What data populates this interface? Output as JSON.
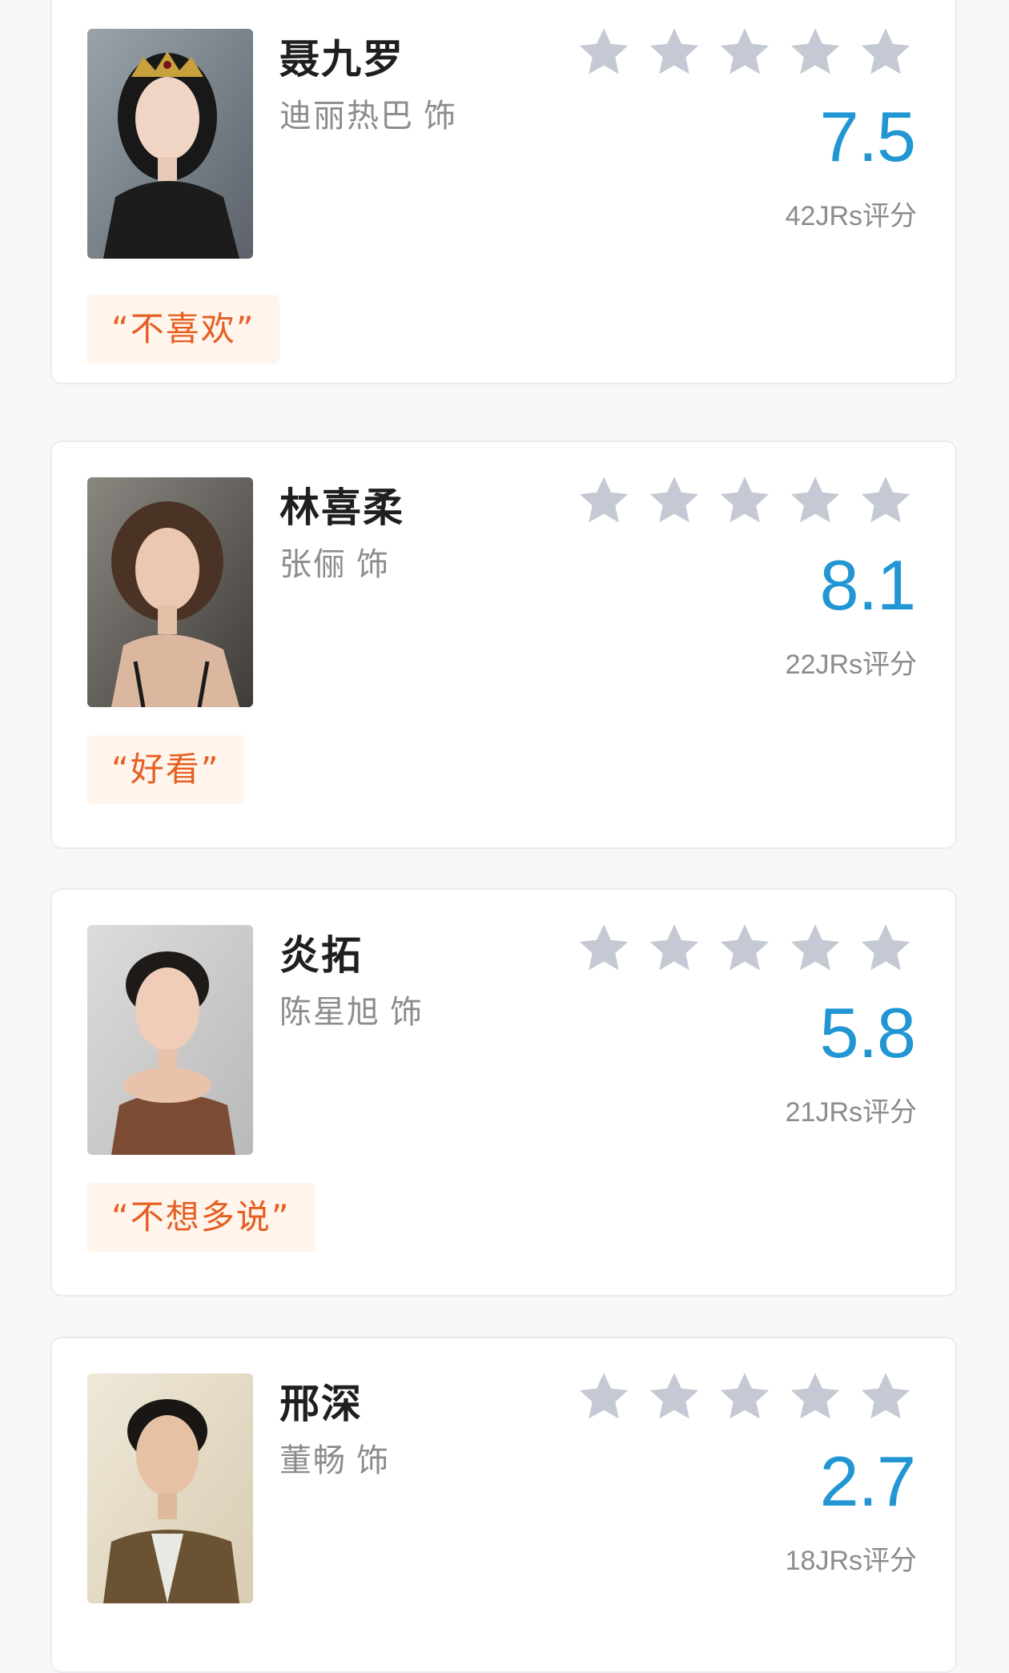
{
  "colors": {
    "accent_score": "#2196d3",
    "star_empty": "#c4c9d4",
    "comment_text": "#e65e21",
    "comment_bg": "#fff5ec"
  },
  "characters": [
    {
      "name": "聂九罗",
      "actor": "迪丽热巴",
      "actor_suffix": "饰",
      "score": "7.5",
      "rating_count": "42JRs评分",
      "comment": "“不喜欢”",
      "stars_filled": 0,
      "stars_total": 5
    },
    {
      "name": "林喜柔",
      "actor": "张俪",
      "actor_suffix": "饰",
      "score": "8.1",
      "rating_count": "22JRs评分",
      "comment": "“好看”",
      "stars_filled": 0,
      "stars_total": 5
    },
    {
      "name": "炎拓",
      "actor": "陈星旭",
      "actor_suffix": "饰",
      "score": "5.8",
      "rating_count": "21JRs评分",
      "comment": "“不想多说”",
      "stars_filled": 0,
      "stars_total": 5
    },
    {
      "name": "邢深",
      "actor": "董畅",
      "actor_suffix": "饰",
      "score": "2.7",
      "rating_count": "18JRs评分",
      "stars_filled": 0,
      "stars_total": 5
    }
  ]
}
